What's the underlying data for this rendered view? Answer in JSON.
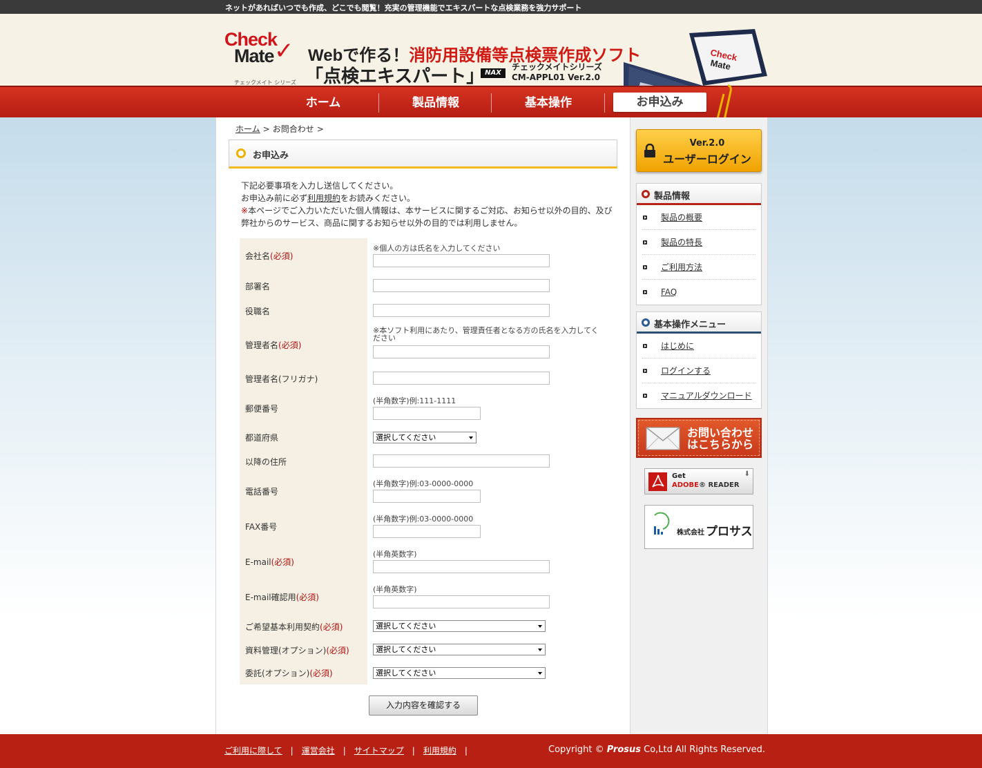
{
  "top_tagline": "ネットがあればいつでも作成、どこでも閲覧！充実の管理機能でエキスパートな点検業務を強力サポート",
  "header": {
    "logo_line1": "Check",
    "logo_line2": "Mate",
    "logo_series": "チェックメイト シリーズ",
    "title_black": "Webで作る！",
    "title_red": "消防用設備等点検票作成ソフト",
    "subtitle": "「点検エキスパート」",
    "nax": "NAX",
    "series_line1": "チェックメイトシリーズ",
    "series_line2": "CM-APPL01 Ver.2.0"
  },
  "nav": {
    "home": "ホーム",
    "products": "製品情報",
    "basics": "基本操作",
    "apply": "お申込み"
  },
  "breadcrumb": {
    "home": "ホーム",
    "sep": ">",
    "current": "お問合わせ"
  },
  "section_title": "お申込み",
  "intro": {
    "line1": "下記必要事項を入力し送信してください。",
    "line2a": "お申込み前に必ず",
    "line2_link": "利用規約",
    "line2b": "をお読みください。",
    "notice_mark": "※",
    "notice": "本ページでご入力いただいた個人情報は、本サービスに関するご対応、お知らせ以外の目的、及び弊社からのサービス、商品に関するお知らせ以外の目的では利用しません。"
  },
  "form": {
    "required": "(必須)",
    "company": {
      "label": "会社名",
      "note": "※個人の方は氏名を入力してください"
    },
    "department": {
      "label": "部署名"
    },
    "position": {
      "label": "役職名"
    },
    "manager": {
      "label": "管理者名",
      "note": "※本ソフト利用にあたり、管理責任者となる方の氏名を入力してください"
    },
    "manager_kana": {
      "label": "管理者名(フリガナ)"
    },
    "postal": {
      "label": "郵便番号",
      "note": "(半角数字)例:111-1111"
    },
    "prefecture": {
      "label": "都道府県",
      "value": "選択してください"
    },
    "address": {
      "label": "以降の住所"
    },
    "phone": {
      "label": "電話番号",
      "note": "(半角数字)例:03-0000-0000"
    },
    "fax": {
      "label": "FAX番号",
      "note": "(半角数字)例:03-0000-0000"
    },
    "email": {
      "label": "E-mail",
      "note": "(半角英数字)"
    },
    "email_confirm": {
      "label": "E-mail確認用",
      "note": "(半角英数字)"
    },
    "contract": {
      "label": "ご希望基本利用契約",
      "value": "選択してください"
    },
    "doc_mgmt": {
      "label": "資料管理(オプション)",
      "value": "選択してください"
    },
    "outsourcing": {
      "label": "委託(オプション)",
      "value": "選択してください"
    },
    "submit": "入力内容を確認する"
  },
  "sidebar": {
    "login_version": "Ver.2.0",
    "login_label": "ユーザーログイン",
    "products_title": "製品情報",
    "products_items": [
      "製品の概要",
      "製品の特長",
      "ご利用方法",
      "FAQ"
    ],
    "basics_title": "基本操作メニュー",
    "basics_items": [
      "はじめに",
      "ログインする",
      "マニュアルダウンロード"
    ],
    "contact_line1": "お問い合わせ",
    "contact_line2": "はこちらから",
    "adobe_get": "Get",
    "adobe_brand": "ADOBE",
    "adobe_reader": "READER",
    "prosus_kk": "株式会社",
    "prosus_name": "プロサス"
  },
  "footer": {
    "links": [
      "ご利用に際して",
      "運営会社",
      "サイトマップ",
      "利用規約"
    ],
    "sep": "|",
    "copy_pre": "Copyright ©",
    "copy_brand": "Prosus",
    "copy_post": "Co,Ltd All Rights Reserved."
  },
  "colors": {
    "brand_red": "#b72012",
    "accent_yellow": "#f2b81c",
    "nav_red": "#d63320"
  }
}
